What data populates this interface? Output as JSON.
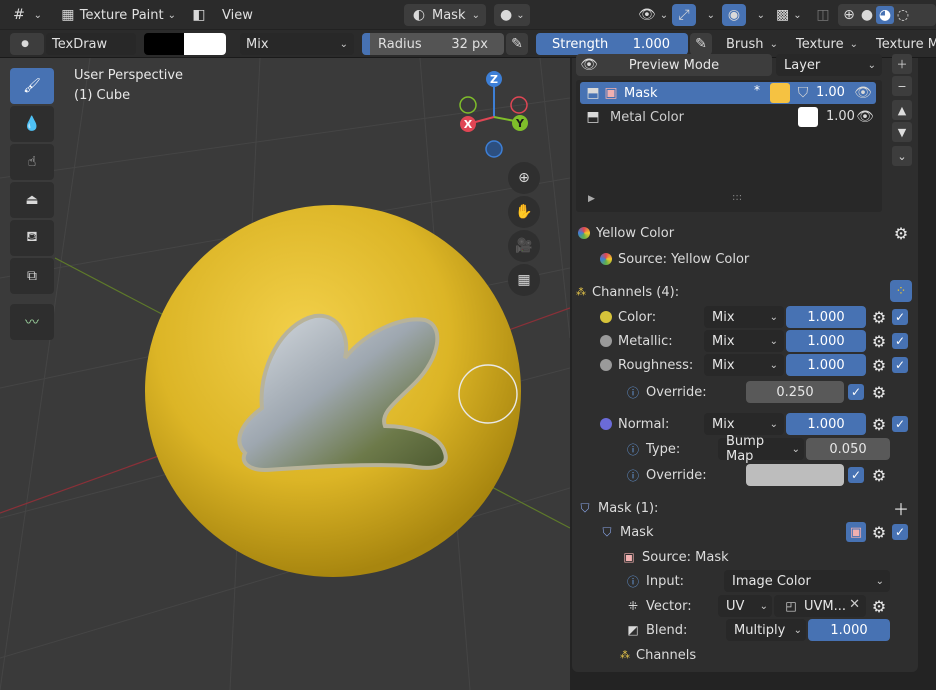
{
  "header": {
    "editor_type": "Texture Paint",
    "view_menu": "View",
    "mask_mode": "Mask"
  },
  "toolbar": {
    "brush_name": "TexDraw",
    "blend_mode": "Mix",
    "radius_label": "Radius",
    "radius_value": "32 px",
    "strength_label": "Strength",
    "strength_value": "1.000",
    "brush_menu": "Brush",
    "texture_menu": "Texture",
    "texture_menu2": "Texture M"
  },
  "viewport": {
    "perspective_label": "User Perspective",
    "object_label": "(1) Cube",
    "gizmo": {
      "z": "Z",
      "x": "X",
      "y": "Y"
    }
  },
  "layers": {
    "preview_mode": "Preview Mode",
    "layer_tab": "Layer",
    "items": [
      {
        "name": "Mask",
        "opacity": "1.00",
        "swatch": "#f5c242"
      },
      {
        "name": "Metal Color",
        "opacity": "1.00",
        "swatch": "#ffffff"
      }
    ],
    "grip": ":::"
  },
  "material": {
    "title": "Yellow Color",
    "source": "Source: Yellow Color",
    "channels_header": "Channels (4):",
    "channels": [
      {
        "name": "Color:",
        "blend": "Mix",
        "value": "1.000",
        "dot": "#d7c43a"
      },
      {
        "name": "Metallic:",
        "blend": "Mix",
        "value": "1.000",
        "dot": "#9a9a9a"
      },
      {
        "name": "Roughness:",
        "blend": "Mix",
        "value": "1.000",
        "dot": "#9a9a9a"
      }
    ],
    "roughness_override_label": "Override:",
    "roughness_override_value": "0.250",
    "normal": {
      "name": "Normal:",
      "blend": "Mix",
      "value": "1.000",
      "dot": "#6b6bd8"
    },
    "type_label": "Type:",
    "type_value": "Bump Map",
    "type_amount": "0.050",
    "normal_override_label": "Override:"
  },
  "mask": {
    "header": "Mask (1):",
    "item": "Mask",
    "source": "Source: Mask",
    "input_label": "Input:",
    "input_value": "Image Color",
    "vector_label": "Vector:",
    "vector_mode": "UV",
    "vector_map": "UVM...",
    "blend_label": "Blend:",
    "blend_mode": "Multiply",
    "blend_value": "1.000",
    "channels": "Channels"
  },
  "colors": {
    "accent": "#4772b3",
    "sphere": "#e0b82a",
    "panel_bg": "#2e2e2e"
  }
}
